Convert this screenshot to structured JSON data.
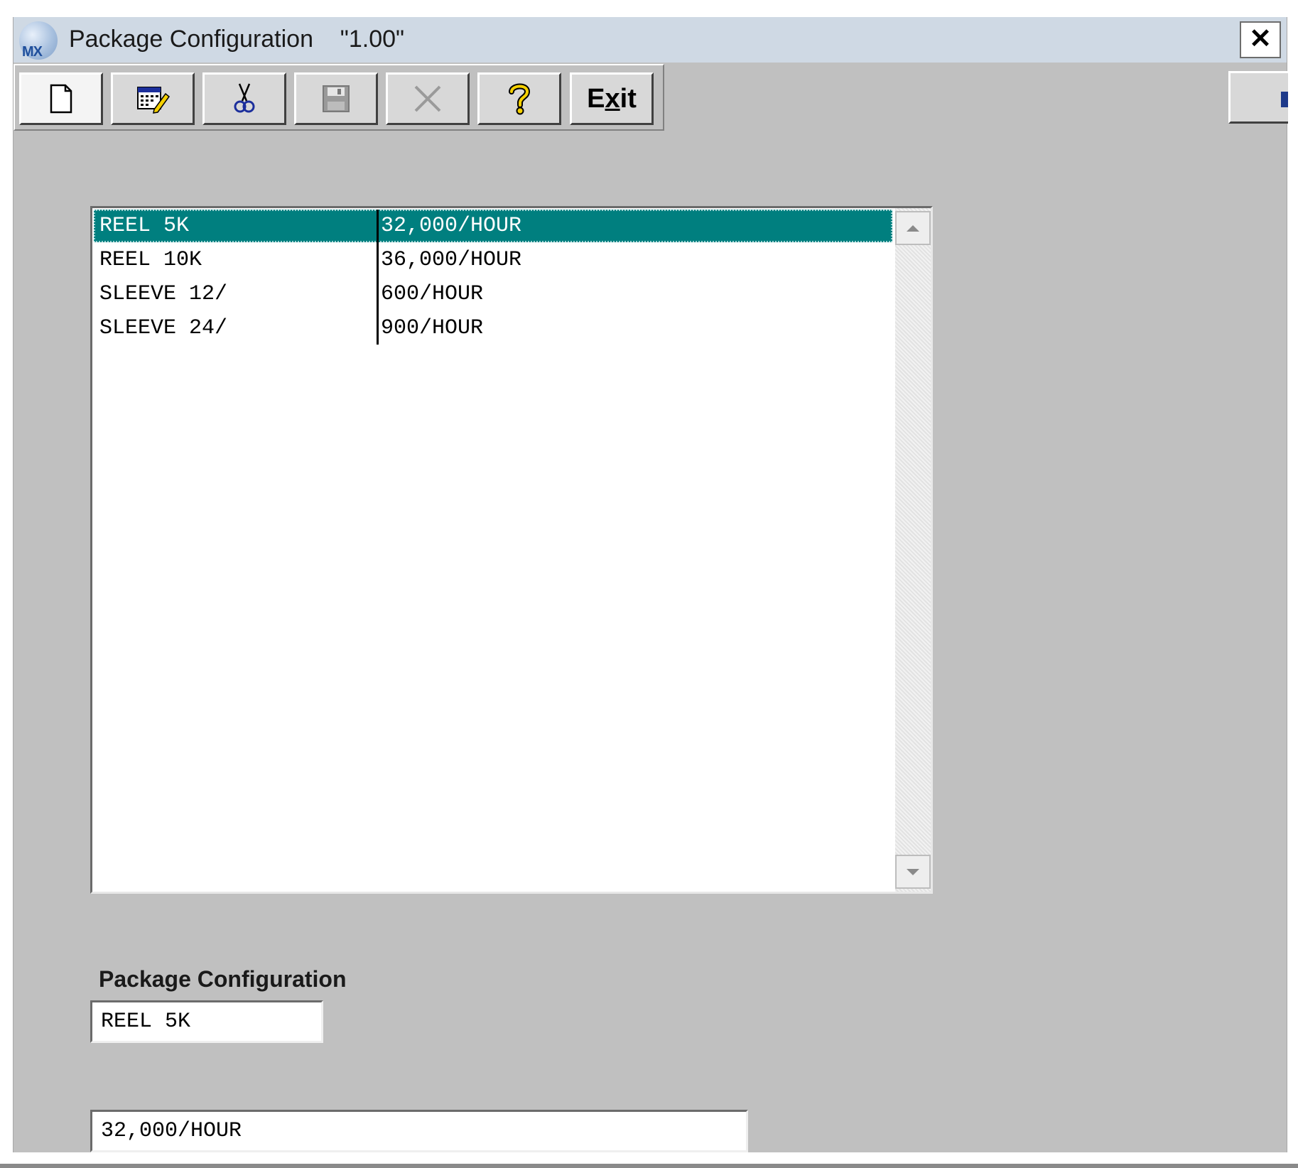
{
  "window": {
    "title": "Package Configuration    \"1.00\"",
    "close_symbol": "✕"
  },
  "app_icon": {
    "left": "MX",
    "accent": "X"
  },
  "toolbar": {
    "buttons": [
      {
        "name": "new-document",
        "icon": "new-document-icon"
      },
      {
        "name": "edit",
        "icon": "edit-calendar-icon"
      },
      {
        "name": "cut",
        "icon": "scissors-icon"
      },
      {
        "name": "save",
        "icon": "floppy-disk-icon",
        "enabled": false
      },
      {
        "name": "delete",
        "icon": "x-icon",
        "enabled": false
      },
      {
        "name": "help",
        "icon": "question-mark-icon"
      }
    ],
    "exit_label_pre": "E",
    "exit_label_accel": "x",
    "exit_label_post": "it"
  },
  "list": {
    "rows": [
      {
        "name": "REEL 5K",
        "rate": "32,000/HOUR",
        "selected": true
      },
      {
        "name": "REEL 10K",
        "rate": "36,000/HOUR",
        "selected": false
      },
      {
        "name": "SLEEVE 12/",
        "rate": "600/HOUR",
        "selected": false
      },
      {
        "name": "SLEEVE 24/",
        "rate": "900/HOUR",
        "selected": false
      }
    ]
  },
  "form": {
    "config_label": "Package Configuration",
    "config_value": "REEL 5K",
    "rate_value": "32,000/HOUR"
  },
  "colors": {
    "selection": "#007f7f",
    "window_bg": "#c0c0c0",
    "titlebar_bg": "#cfd9e4"
  }
}
